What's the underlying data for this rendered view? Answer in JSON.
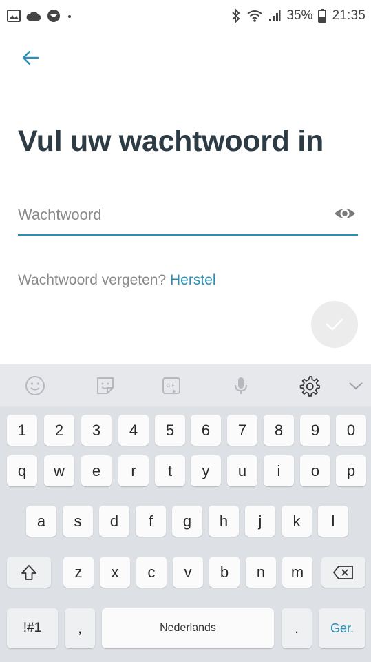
{
  "status_bar": {
    "battery": "35%",
    "time": "21:35",
    "icons": [
      "gallery-icon",
      "cloud-icon",
      "face-icon",
      "dot-icon",
      "bluetooth-icon",
      "wifi-icon",
      "signal-icon",
      "battery-icon"
    ]
  },
  "header": {
    "back_icon": "arrow-left-icon"
  },
  "main": {
    "title": "Vul uw wachtwoord in",
    "password_placeholder": "Wachtwoord",
    "password_value": "",
    "forgot_text": "Wachtwoord vergeten?",
    "forgot_link": "Herstel",
    "submit_icon": "checkmark-icon"
  },
  "keyboard": {
    "toolbar": [
      "emoji-icon",
      "sticker-icon",
      "gif-icon",
      "microphone-icon",
      "settings-icon",
      "chevron-down-icon"
    ],
    "row_numbers": [
      "1",
      "2",
      "3",
      "4",
      "5",
      "6",
      "7",
      "8",
      "9",
      "0"
    ],
    "row1": [
      "q",
      "w",
      "e",
      "r",
      "t",
      "y",
      "u",
      "i",
      "o",
      "p"
    ],
    "row2": [
      "a",
      "s",
      "d",
      "f",
      "g",
      "h",
      "j",
      "k",
      "l"
    ],
    "row3": [
      "z",
      "x",
      "c",
      "v",
      "b",
      "n",
      "m"
    ],
    "symbols_key": "!#1",
    "comma_key": ",",
    "space_label": "Nederlands",
    "period_key": ".",
    "go_key": "Ger."
  },
  "colors": {
    "accent": "#2b8fb6",
    "title": "#2d3b45"
  }
}
